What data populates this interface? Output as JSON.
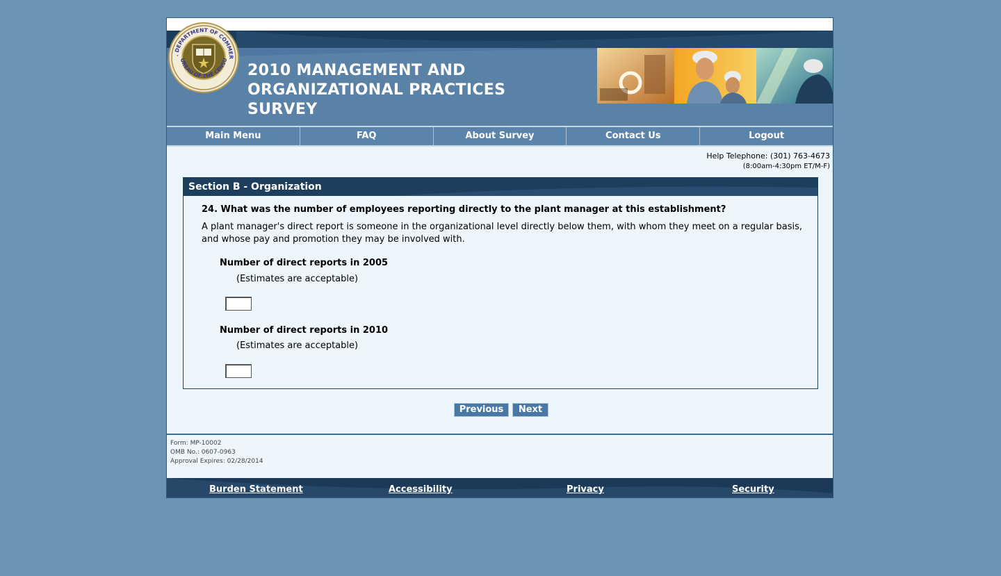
{
  "header": {
    "title_lines": [
      "2010 MANAGEMENT AND",
      "ORGANIZATIONAL PRACTICES",
      "SURVEY"
    ],
    "seal_top_text": "U.S. DEPARTMENT OF COMMERCE",
    "seal_bottom_text": "BUREAU OF THE CENSUS"
  },
  "nav": {
    "items": [
      {
        "label": "Main Menu"
      },
      {
        "label": "FAQ"
      },
      {
        "label": "About Survey"
      },
      {
        "label": "Contact Us"
      },
      {
        "label": "Logout"
      }
    ]
  },
  "help": {
    "telephone": "Help Telephone: (301) 763-4673",
    "hours": "(8:00am-4:30pm ET/M-F)"
  },
  "section": {
    "title": "Section B - Organization",
    "question": "24. What was the number of employees reporting directly to the plant manager at this establishment?",
    "explanation": "A plant manager's direct report is someone in the organizational level directly below them, with whom they meet on a regular basis, and whose pay and promotion they may be involved with.",
    "fields": [
      {
        "label": "Number of direct reports in 2005",
        "note": "(Estimates are acceptable)",
        "value": ""
      },
      {
        "label": "Number of direct reports in 2010",
        "note": "(Estimates are acceptable)",
        "value": ""
      }
    ]
  },
  "buttons": {
    "previous": "Previous",
    "next": "Next"
  },
  "form_info": {
    "form": "Form: MP-10002",
    "omb": "OMB No.: 0607-0963",
    "expires": "Approval Expires: 02/28/2014"
  },
  "footer": {
    "links": [
      {
        "label": "Burden Statement"
      },
      {
        "label": "Accessibility"
      },
      {
        "label": "Privacy"
      },
      {
        "label": "Security"
      }
    ]
  },
  "colors": {
    "background": "#6a93b4",
    "header_blue": "#5a81a6",
    "dark_navy": "#1e3e5e",
    "button": "#4a78a4"
  }
}
